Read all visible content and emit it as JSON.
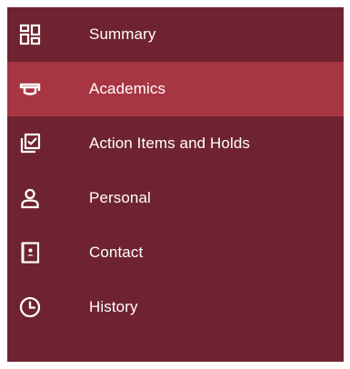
{
  "sidebar": {
    "background": "#6f2330",
    "active_background": "#a83542",
    "text_color": "#ffffff",
    "items": [
      {
        "label": "Summary",
        "icon": "dashboard-grid-icon",
        "active": false
      },
      {
        "label": "Academics",
        "icon": "graduation-cap-icon",
        "active": true
      },
      {
        "label": "Action Items and Holds",
        "icon": "checklist-icon",
        "active": false
      },
      {
        "label": "Personal",
        "icon": "person-icon",
        "active": false
      },
      {
        "label": "Contact",
        "icon": "contact-book-icon",
        "active": false
      },
      {
        "label": "History",
        "icon": "clock-icon",
        "active": false
      }
    ]
  }
}
